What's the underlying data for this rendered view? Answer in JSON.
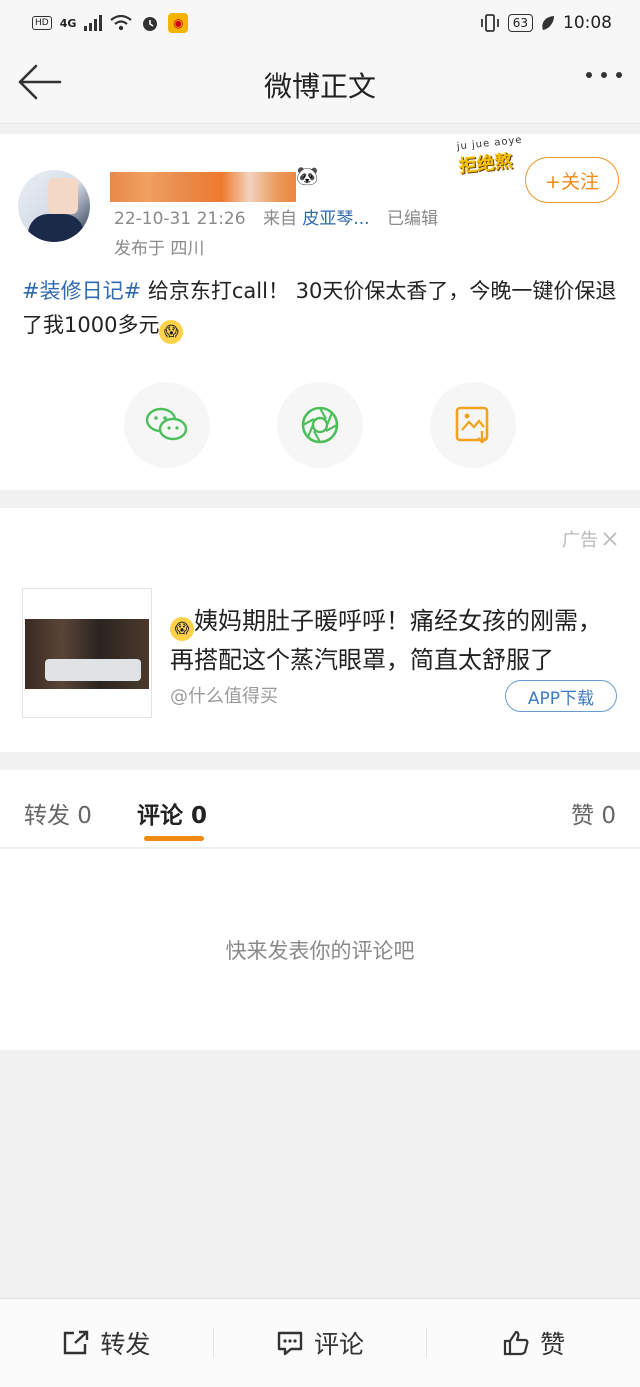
{
  "status_bar": {
    "left_chips": [
      "HD",
      "4G"
    ],
    "battery": "63",
    "time": "10:08"
  },
  "nav": {
    "title": "微博正文"
  },
  "post": {
    "time": "22-10-31 21:26",
    "from_label": "来自",
    "source": "皮亚琴...",
    "edited": "已编辑",
    "location": "发布于 四川",
    "follow_label": "+关注",
    "deco_pinyin": "ju jue aoye",
    "deco_text": "拒绝熬",
    "hashtag": "#装修日记#",
    "text": " 给京东打call！ 30天价保太香了，今晚一键价保退了我1000多元"
  },
  "ad": {
    "label": "广告",
    "text": "姨妈期肚子暖呼呼！痛经女孩的刚需，再搭配这个蒸汽眼罩，简直太舒服了",
    "source": "@什么值得买",
    "button": "APP下载"
  },
  "tabs": {
    "repost": "转发 0",
    "comment": "评论 0",
    "like": "赞 0"
  },
  "comments": {
    "empty": "快来发表你的评论吧"
  },
  "bottom_bar": {
    "repost": "转发",
    "comment": "评论",
    "like": "赞"
  },
  "colors": {
    "accent": "#f08a14",
    "link": "#2f6ab0",
    "wechat_green": "#4cbf5a",
    "gallery_orange": "#f3a21d"
  }
}
